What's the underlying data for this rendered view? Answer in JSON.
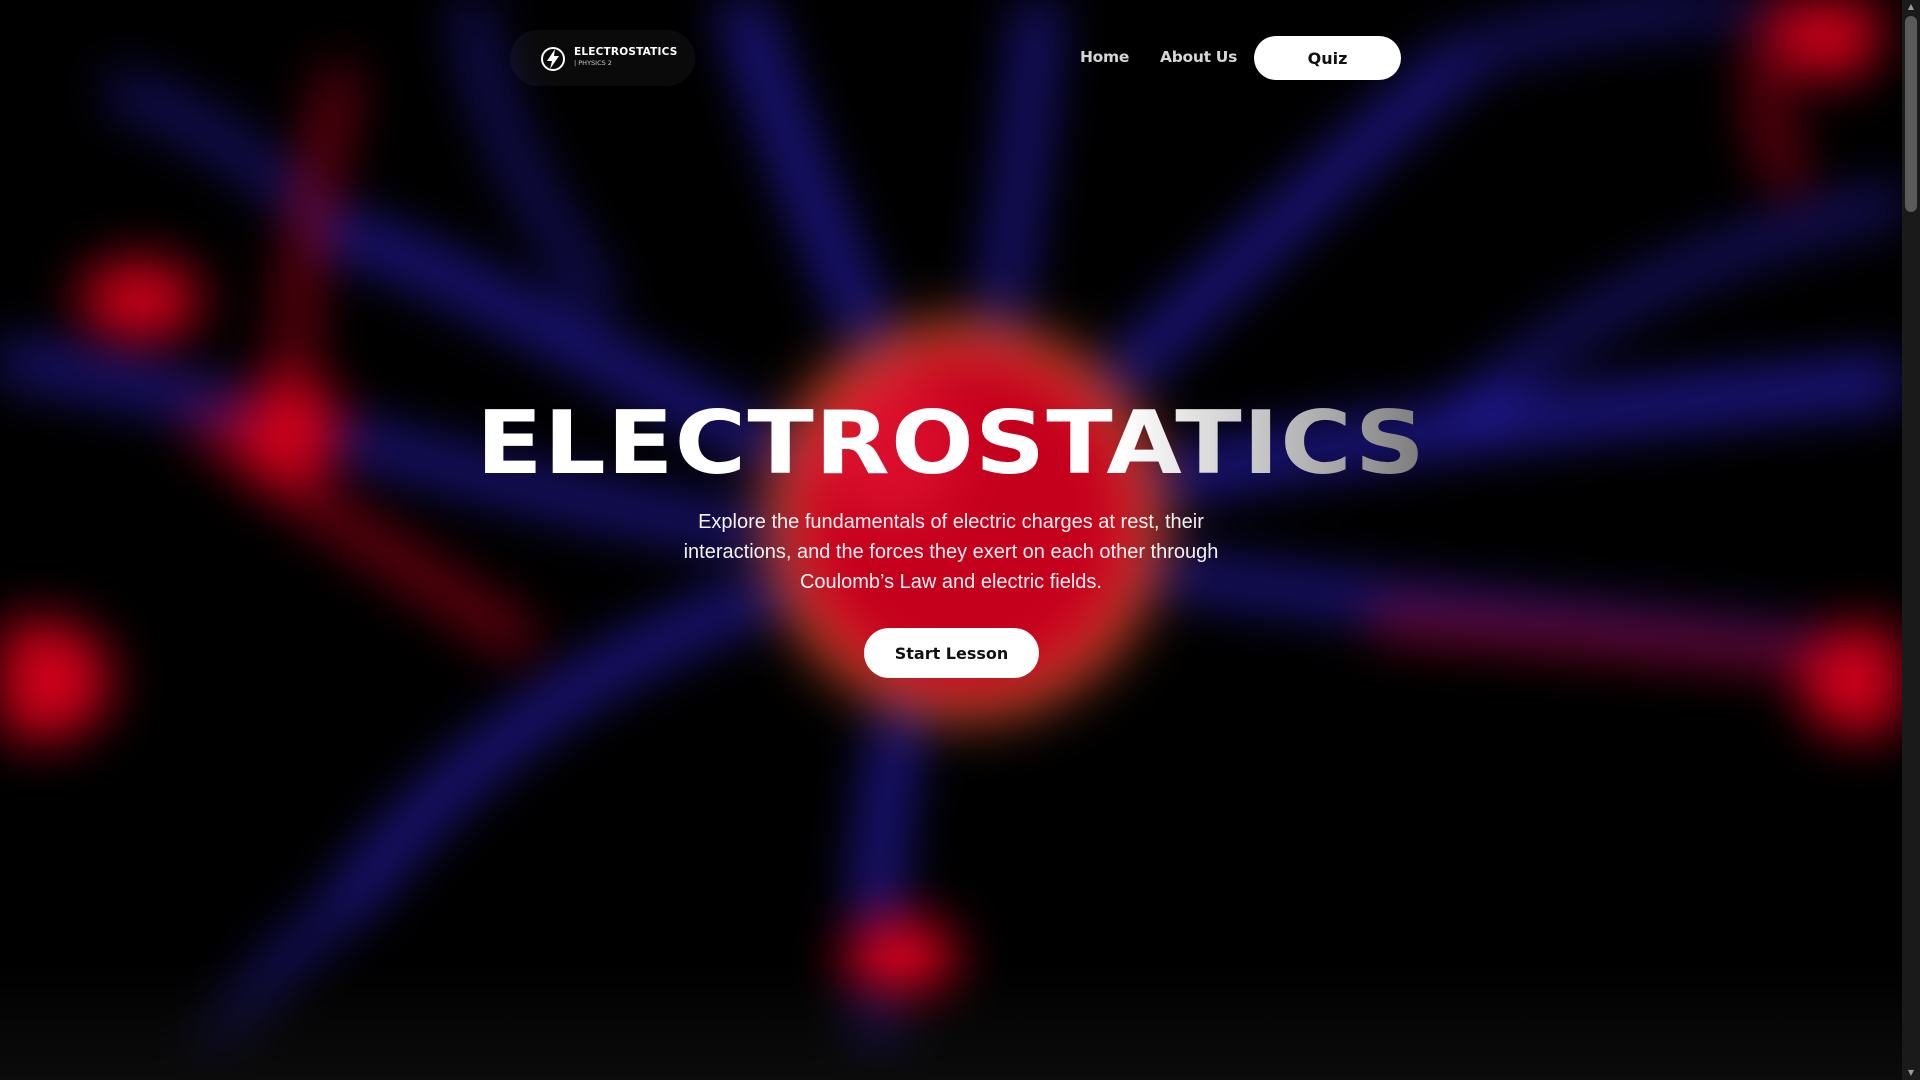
{
  "brand": {
    "title": "ELECTROSTATICS",
    "subtitle": "| PHYSICS 2",
    "icon": "lightning-bolt-icon"
  },
  "nav": {
    "links": [
      {
        "label": "Home"
      },
      {
        "label": "About Us"
      }
    ],
    "quiz_label": "Quiz"
  },
  "hero": {
    "title": "ELECTROSTATICS",
    "description": "Explore the fundamentals of electric charges at rest, their interactions, and the forces they exert on each other through Coulomb’s Law and electric fields.",
    "cta_label": "Start Lesson"
  },
  "scrollbar": {
    "up_icon": "scroll-up-arrow-icon",
    "down_icon": "scroll-down-arrow-icon"
  },
  "colors": {
    "background": "#000000",
    "plasma_red": "#d1001c",
    "plasma_blue": "#2a1fbf",
    "button_bg": "#ffffff",
    "button_text": "#111111"
  }
}
